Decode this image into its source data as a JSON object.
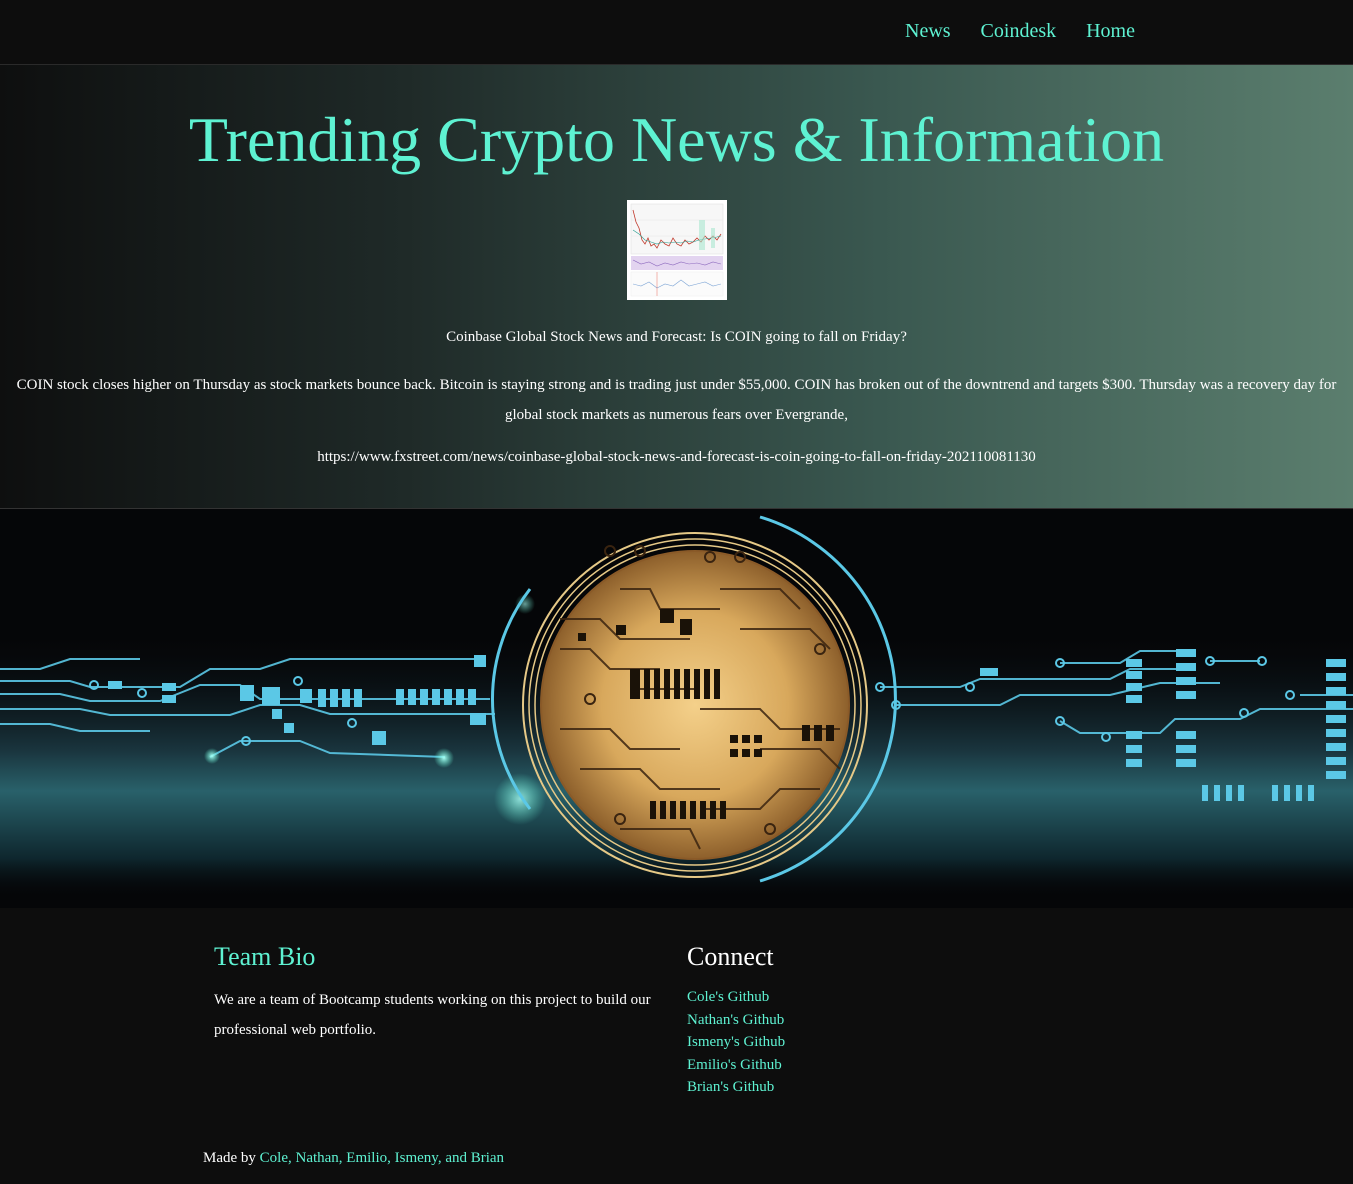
{
  "nav": {
    "items": [
      {
        "label": "News"
      },
      {
        "label": "Coindesk"
      },
      {
        "label": "Home"
      }
    ]
  },
  "hero": {
    "title": "Trending Crypto News & Information",
    "article": {
      "title": "Coinbase Global Stock News and Forecast: Is COIN going to fall on Friday?",
      "description": "COIN stock closes higher on Thursday as stock markets bounce back. Bitcoin is staying strong and is trading just under $55,000. COIN has broken out of the downtrend and targets $300. Thursday was a recovery day for global stock markets as numerous fears over Evergrande,",
      "url": "https://www.fxstreet.com/news/coinbase-global-stock-news-and-forecast-is-coin-going-to-fall-on-friday-202110081130"
    }
  },
  "footer": {
    "bio": {
      "heading": "Team Bio",
      "text": "We are a team of Bootcamp students working on this project to build our professional web portfolio."
    },
    "connect": {
      "heading": "Connect",
      "links": [
        {
          "label": "Cole's Github"
        },
        {
          "label": "Nathan's Github"
        },
        {
          "label": "Ismeny's Github"
        },
        {
          "label": "Emilio's Github"
        },
        {
          "label": "Brian's Github"
        }
      ]
    },
    "credit": {
      "prefix": "Made by",
      "names": "Cole, Nathan, Emilio, Ismeny, and Brian"
    }
  },
  "colors": {
    "accent": "#5ef2d2",
    "background": "#0d0d0d",
    "circuit": "#5bc8e6",
    "coin": "#d9a85a"
  }
}
